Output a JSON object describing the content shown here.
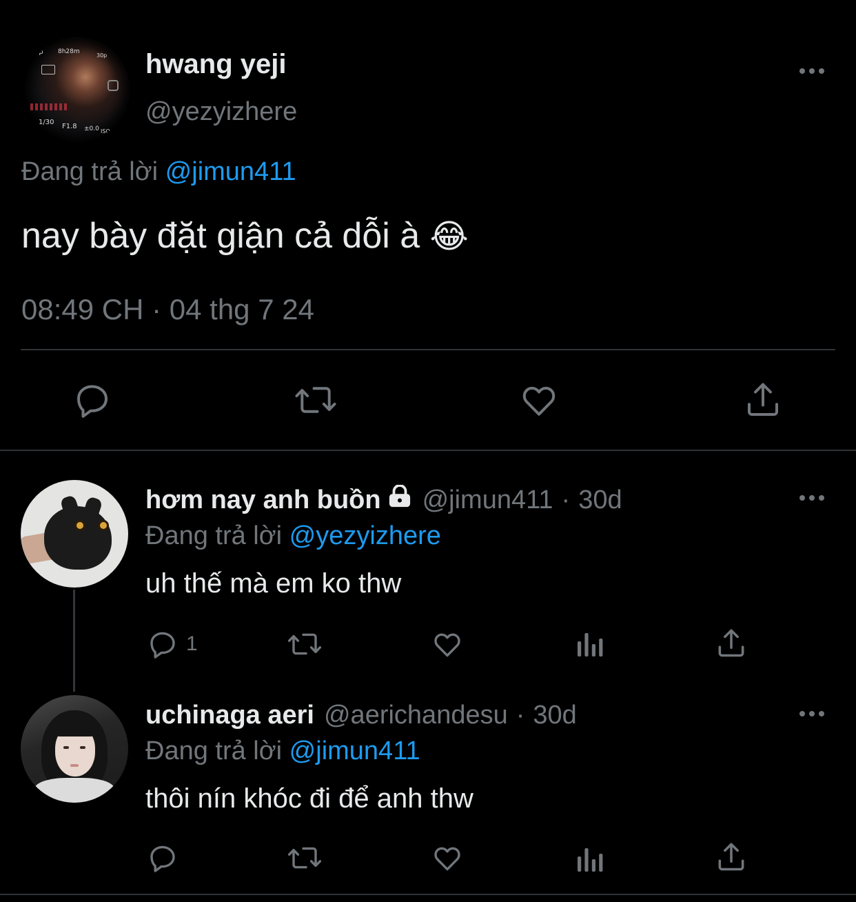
{
  "main_tweet": {
    "display_name": "hwang yeji",
    "handle": "@yezyizhere",
    "reply_prefix": "Đang trả lời",
    "reply_to": "@jimun411",
    "text": "nay bày đặt giận cả dỗi à",
    "emoji": "😂",
    "timestamp": "08:49 CH · 04 thg 7 24",
    "avatar_overlay": {
      "top_left": "3p",
      "top_mid": "8h28m",
      "top_right": "30p",
      "bottom_left": "1/30",
      "bottom_mid": "F1.8",
      "bottom_right": "±0.0",
      "bottom_far": "ISO"
    }
  },
  "replies": [
    {
      "display_name": "hơm nay anh buồn",
      "lock_icon": "lock-icon",
      "handle": "@jimun411",
      "separator": "·",
      "age": "30d",
      "reply_prefix": "Đang trả lời",
      "reply_to": "@yezyizhere",
      "text": "uh thế mà em ko thw",
      "reply_count": "1"
    },
    {
      "display_name": "uchinaga aeri",
      "handle": "@aerichandesu",
      "separator": "·",
      "age": "30d",
      "reply_prefix": "Đang trả lời",
      "reply_to": "@jimun411",
      "text": "thôi nín khóc đi để anh thw",
      "reply_count": ""
    }
  ],
  "icons": {
    "more": "more-icon",
    "reply": "reply-icon",
    "retweet": "retweet-icon",
    "like": "heart-icon",
    "views": "views-icon",
    "share": "share-icon"
  },
  "colors": {
    "background": "#000000",
    "text": "#e7e9ea",
    "secondary": "#71767b",
    "link": "#1d9bf0",
    "divider": "#2f3336"
  }
}
